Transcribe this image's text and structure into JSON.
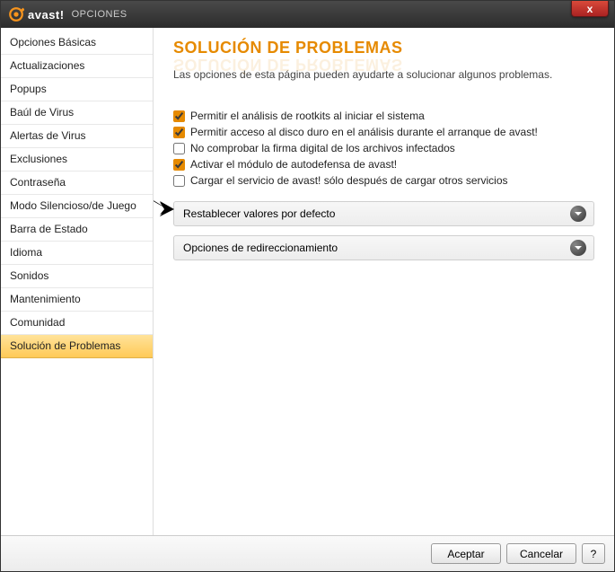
{
  "header": {
    "brand": "avast!",
    "section": "OPCIONES",
    "close": "x"
  },
  "sidebar": {
    "items": [
      {
        "label": "Opciones Básicas"
      },
      {
        "label": "Actualizaciones"
      },
      {
        "label": "Popups"
      },
      {
        "label": "Baúl de Virus"
      },
      {
        "label": "Alertas de Virus"
      },
      {
        "label": "Exclusiones"
      },
      {
        "label": "Contraseña"
      },
      {
        "label": "Modo Silencioso/de Juego"
      },
      {
        "label": "Barra de Estado"
      },
      {
        "label": "Idioma"
      },
      {
        "label": "Sonidos"
      },
      {
        "label": "Mantenimiento"
      },
      {
        "label": "Comunidad"
      },
      {
        "label": "Solución de Problemas"
      }
    ],
    "active_index": 13
  },
  "page": {
    "title": "SOLUCIÓN DE PROBLEMAS",
    "desc": "Las opciones de esta página pueden ayudarte a solucionar algunos problemas.",
    "checks": [
      {
        "label": "Permitir el análisis de rootkits al iniciar el sistema",
        "checked": true
      },
      {
        "label": "Permitir acceso al disco duro en el análisis durante el arranque de avast!",
        "checked": true
      },
      {
        "label": "No comprobar la firma digital de los archivos infectados",
        "checked": false
      },
      {
        "label": "Activar el módulo de autodefensa de avast!",
        "checked": true
      },
      {
        "label": "Cargar el servicio de avast! sólo después de cargar otros servicios",
        "checked": false
      }
    ],
    "expanders": [
      {
        "label": "Restablecer valores por defecto"
      },
      {
        "label": "Opciones de redireccionamiento"
      }
    ]
  },
  "footer": {
    "ok": "Aceptar",
    "cancel": "Cancelar",
    "help": "?"
  }
}
